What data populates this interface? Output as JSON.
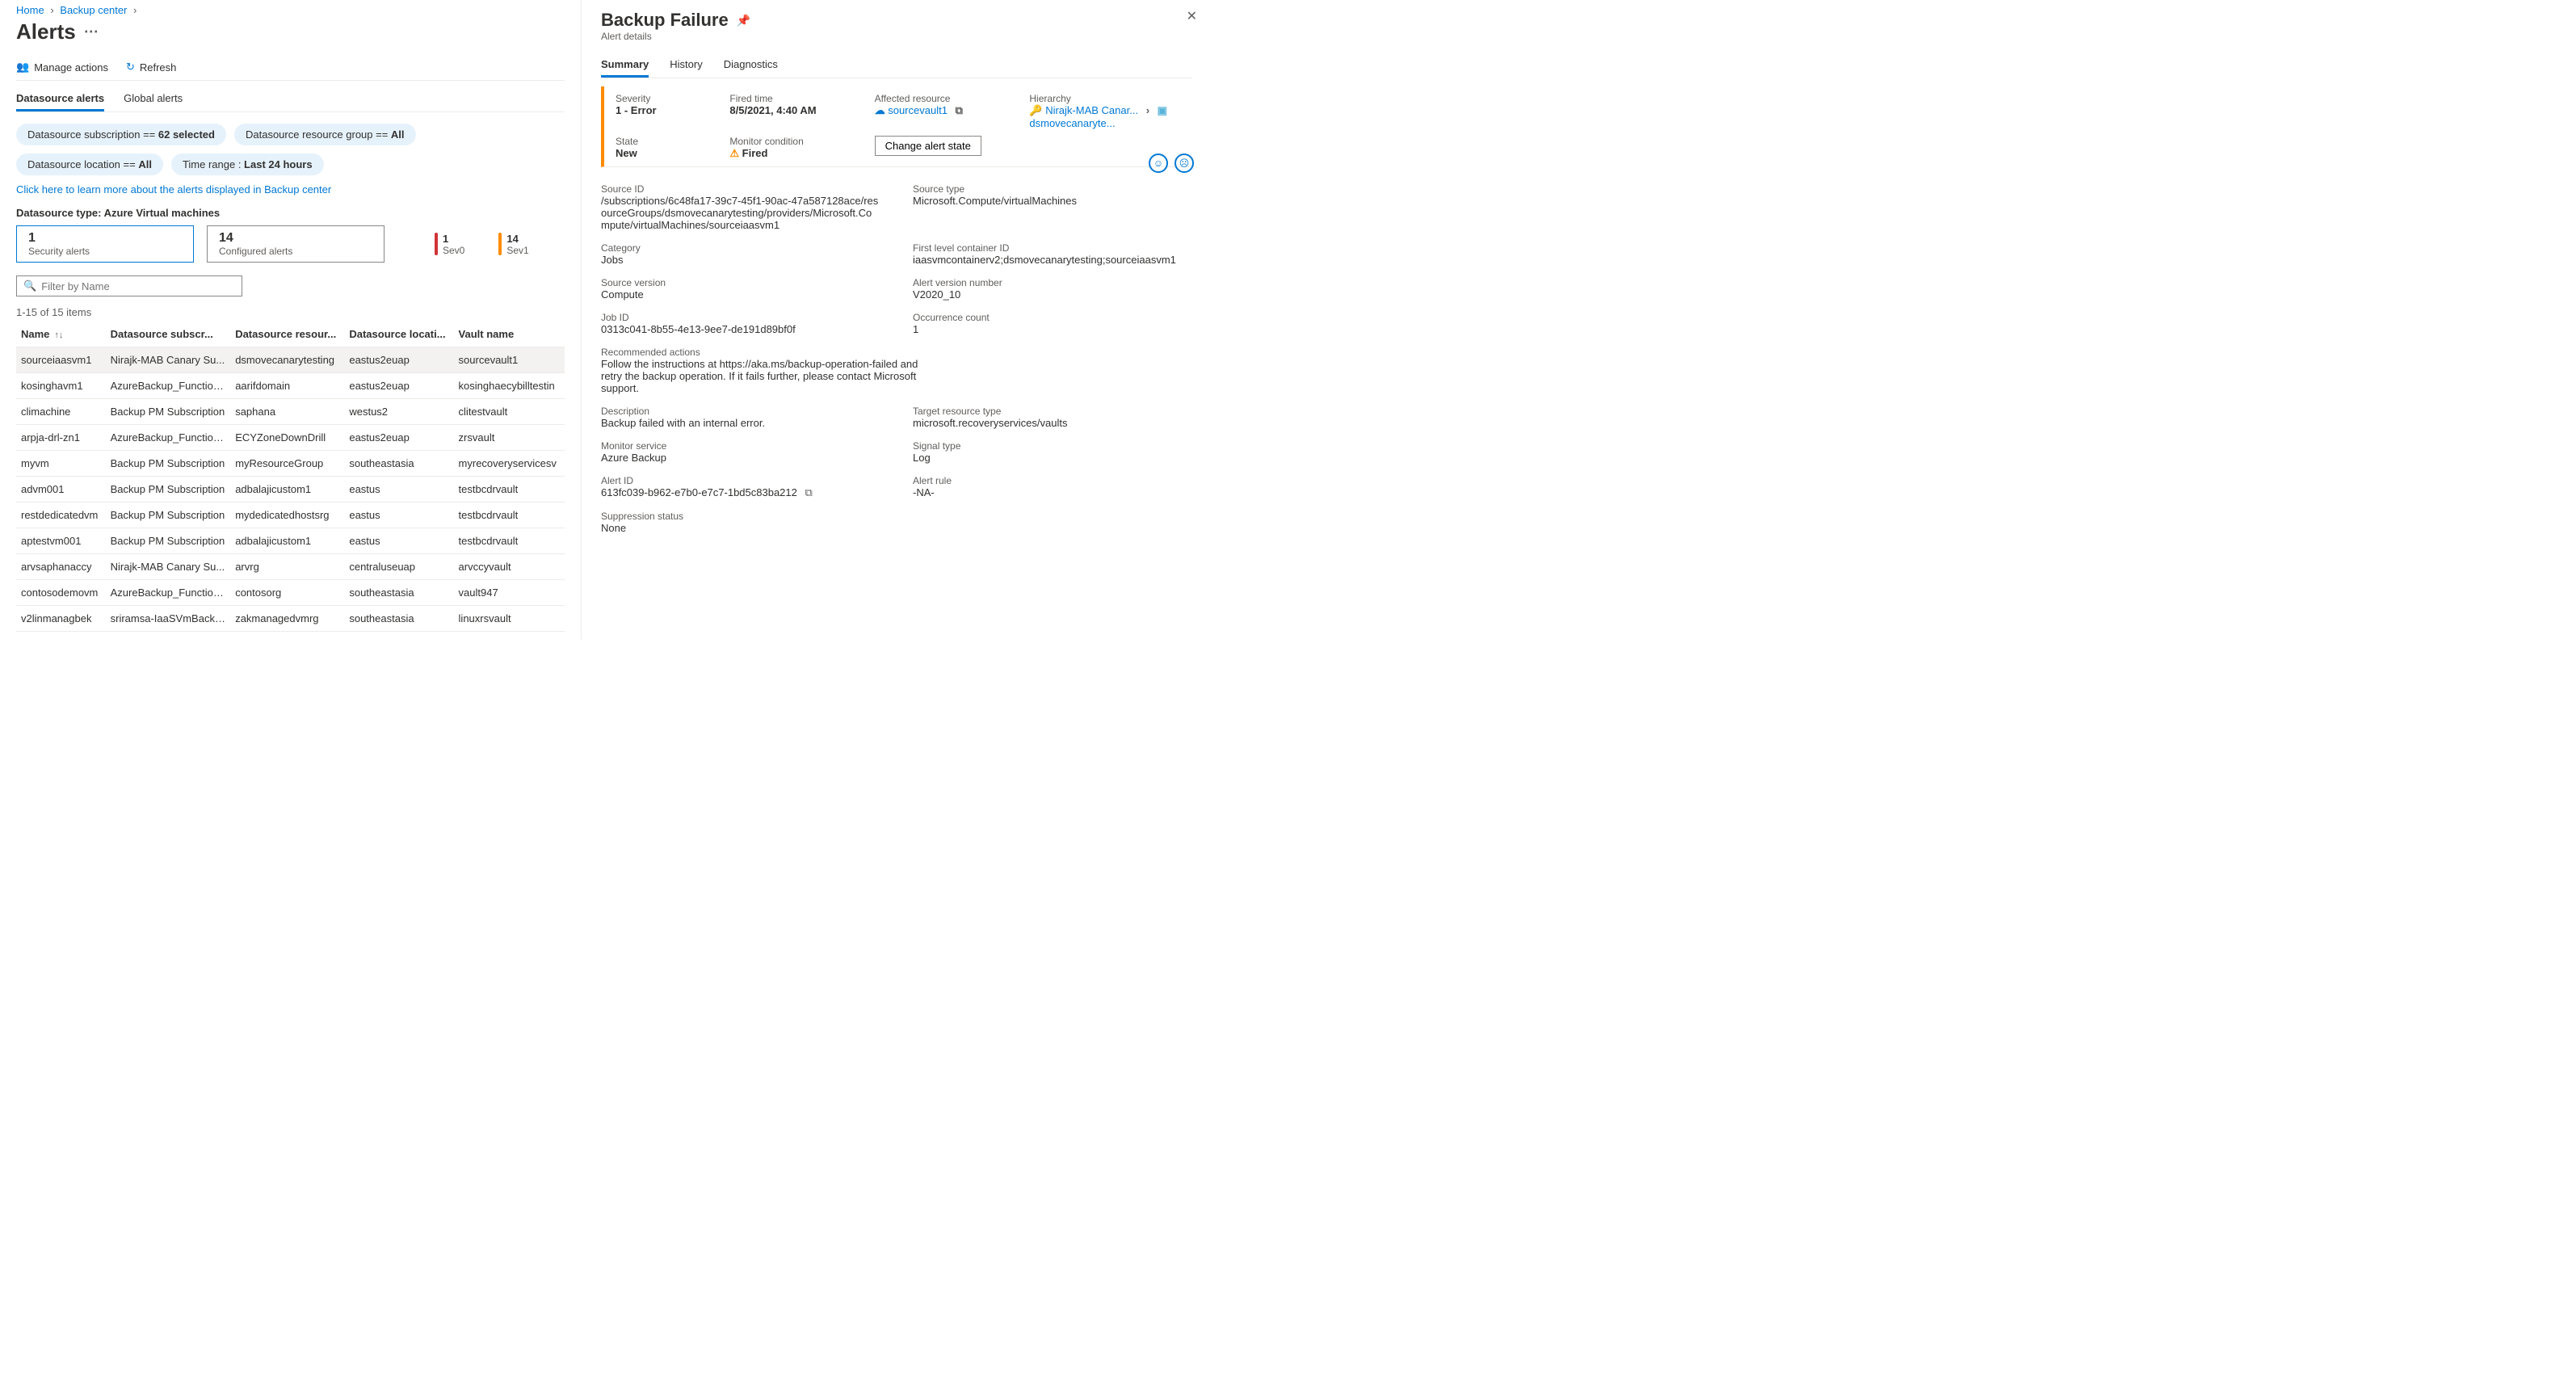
{
  "breadcrumb": {
    "home": "Home",
    "center": "Backup center"
  },
  "page": {
    "title": "Alerts"
  },
  "cmds": {
    "manage": "Manage actions",
    "refresh": "Refresh"
  },
  "alert_tabs": {
    "ds": "Datasource alerts",
    "global": "Global alerts"
  },
  "pills": {
    "sub_pre": "Datasource subscription == ",
    "sub_val": "62 selected",
    "rg_pre": "Datasource resource group == ",
    "rg_val": "All",
    "loc_pre": "Datasource location == ",
    "loc_val": "All",
    "time_pre": "Time range : ",
    "time_val": "Last 24 hours"
  },
  "learn": "Click here to learn more about the alerts displayed in Backup center",
  "dstype": "Datasource type: Azure Virtual machines",
  "cards": {
    "sec_n": "1",
    "sec_l": "Security alerts",
    "cfg_n": "14",
    "cfg_l": "Configured alerts"
  },
  "sev": {
    "s0n": "1",
    "s0l": "Sev0",
    "s1n": "14",
    "s1l": "Sev1"
  },
  "filter_ph": "Filter by Name",
  "count": "1-15 of 15 items",
  "cols": {
    "name": "Name",
    "sub": "Datasource subscr...",
    "rg": "Datasource resour...",
    "loc": "Datasource locati...",
    "vault": "Vault name"
  },
  "rows": [
    {
      "n": "sourceiaasvm1",
      "s": "Nirajk-MAB Canary Su...",
      "r": "dsmovecanarytesting",
      "l": "eastus2euap",
      "v": "sourcevault1"
    },
    {
      "n": "kosinghavm1",
      "s": "AzureBackup_Function...",
      "r": "aarifdomain",
      "l": "eastus2euap",
      "v": "kosinghaecybilltestin"
    },
    {
      "n": "climachine",
      "s": "Backup PM Subscription",
      "r": "saphana",
      "l": "westus2",
      "v": "clitestvault"
    },
    {
      "n": "arpja-drl-zn1",
      "s": "AzureBackup_Function...",
      "r": "ECYZoneDownDrill",
      "l": "eastus2euap",
      "v": "zrsvault"
    },
    {
      "n": "myvm",
      "s": "Backup PM Subscription",
      "r": "myResourceGroup",
      "l": "southeastasia",
      "v": "myrecoveryservicesv"
    },
    {
      "n": "advm001",
      "s": "Backup PM Subscription",
      "r": "adbalajicustom1",
      "l": "eastus",
      "v": "testbcdrvault"
    },
    {
      "n": "restdedicatedvm",
      "s": "Backup PM Subscription",
      "r": "mydedicatedhostsrg",
      "l": "eastus",
      "v": "testbcdrvault"
    },
    {
      "n": "aptestvm001",
      "s": "Backup PM Subscription",
      "r": "adbalajicustom1",
      "l": "eastus",
      "v": "testbcdrvault"
    },
    {
      "n": "arvsaphanaccy",
      "s": "Nirajk-MAB Canary Su...",
      "r": "arvrg",
      "l": "centraluseuap",
      "v": "arvccyvault"
    },
    {
      "n": "contosodemovm",
      "s": "AzureBackup_Function...",
      "r": "contosorg",
      "l": "southeastasia",
      "v": "vault947"
    },
    {
      "n": "v2linmanagbek",
      "s": "sriramsa-IaaSVmBacku...",
      "r": "zakmanagedvmrg",
      "l": "southeastasia",
      "v": "linuxrsvault"
    }
  ],
  "panel": {
    "title": "Backup Failure",
    "subtitle": "Alert details",
    "tabs": {
      "summary": "Summary",
      "history": "History",
      "diag": "Diagnostics"
    },
    "summary": {
      "sev_l": "Severity",
      "sev_v": "1 - Error",
      "fired_l": "Fired time",
      "fired_v": "8/5/2021, 4:40 AM",
      "aff_l": "Affected resource",
      "aff_v": "sourcevault1",
      "hier_l": "Hierarchy",
      "hier_v1": "Nirajk-MAB Canar...",
      "hier_v2": "dsmovecanaryte...",
      "state_l": "State",
      "state_v": "New",
      "mon_l": "Monitor condition",
      "mon_v": "Fired",
      "change_btn": "Change alert state"
    },
    "details": {
      "src_id_l": "Source ID",
      "src_id_v": "/subscriptions/6c48fa17-39c7-45f1-90ac-47a587128ace/resourceGroups/dsmovecanarytesting/providers/Microsoft.Compute/virtualMachines/sourceiaasvm1",
      "src_type_l": "Source type",
      "src_type_v": "Microsoft.Compute/virtualMachines",
      "cat_l": "Category",
      "cat_v": "Jobs",
      "flc_l": "First level container ID",
      "flc_v": "iaasvmcontainerv2;dsmovecanarytesting;sourceiaasvm1",
      "sv_l": "Source version",
      "sv_v": "Compute",
      "av_l": "Alert version number",
      "av_v": "V2020_10",
      "job_l": "Job ID",
      "job_v": "0313c041-8b55-4e13-9ee7-de191d89bf0f",
      "occ_l": "Occurrence count",
      "occ_v": "1",
      "rec_l": "Recommended actions",
      "rec_v": "Follow the instructions at https://aka.ms/backup-operation-failed and retry the backup operation. If it fails further, please contact Microsoft support.",
      "desc_l": "Description",
      "desc_v": "Backup failed with an internal error.",
      "trt_l": "Target resource type",
      "trt_v": "microsoft.recoveryservices/vaults",
      "ms_l": "Monitor service",
      "ms_v": "Azure Backup",
      "sig_l": "Signal type",
      "sig_v": "Log",
      "aid_l": "Alert ID",
      "aid_v": "613fc039-b962-e7b0-e7c7-1bd5c83ba212",
      "ar_l": "Alert rule",
      "ar_v": "-NA-",
      "sup_l": "Suppression status",
      "sup_v": "None"
    }
  }
}
